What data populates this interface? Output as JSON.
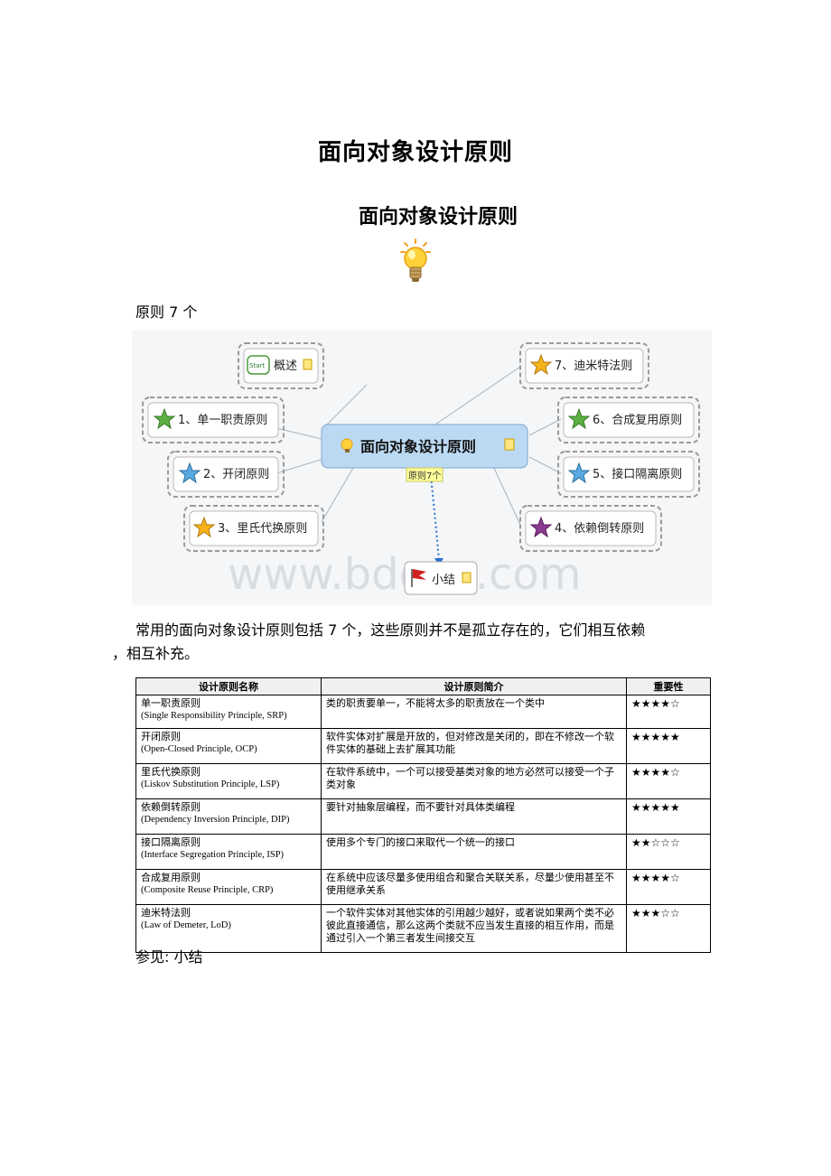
{
  "document": {
    "title": "面向对象设计原则",
    "subtitle": "面向对象设计原则",
    "count_line": "原则 7 个",
    "description_line1": "常用的面向对象设计原则包括 7 个，这些原则并不是孤立存在的，它们相互依赖",
    "description_line2": "，相互补充。",
    "see_also": "参见: 小结"
  },
  "mindmap": {
    "center": "面向对象设计原则",
    "link_label": "原则7个",
    "start_badge": "Start",
    "watermark": "www.bdocx.com",
    "nodes": {
      "overview": "概述",
      "srp": "1、单一职责原则",
      "ocp": "2、开闭原则",
      "lsp": "3、里氏代换原则",
      "dip": "4、依赖倒转原则",
      "isp": "5、接口隔离原则",
      "crp": "6、合成复用原则",
      "lod": "7、迪米特法则",
      "summary": "小结"
    },
    "colors": {
      "green_star": "#5bb040",
      "blue_star": "#5aa9df",
      "yellow_star": "#f5b21b",
      "purple_star": "#8b3c8e",
      "center_fill": "#bcd9f3",
      "link_label_bg": "#ffff99"
    }
  },
  "table": {
    "headers": [
      "设计原则名称",
      "设计原则简介",
      "重要性"
    ],
    "rows": [
      {
        "name": "单一职责原则",
        "en": "(Single Responsibility  Principle, SRP)",
        "desc": "类的职责要单一，不能将太多的职责放在一个类中",
        "stars": "★★★★☆"
      },
      {
        "name": "开闭原则",
        "en": "(Open-Closed Principle,  OCP)",
        "desc": "软件实体对扩展是开放的，但对修改是关闭的，即在不修改一个软件实体的基础上去扩展其功能",
        "stars": "★★★★★"
      },
      {
        "name": "里氏代换原则",
        "en": "(Liskov Substitution  Principle, LSP)",
        "desc": "在软件系统中，一个可以接受基类对象的地方必然可以接受一个子类对象",
        "stars": "★★★★☆"
      },
      {
        "name": "依赖倒转原则",
        "en": "(Dependency Inversion Principle, DIP)",
        "desc": "要针对抽象层编程，而不要针对具体类编程",
        "stars": "★★★★★"
      },
      {
        "name": "接口隔离原则",
        "en": "(Interface  Segregation  Principle, ISP)",
        "desc": "使用多个专门的接口来取代一个统一的接口",
        "stars": "★★☆☆☆"
      },
      {
        "name": "合成复用原则",
        "en": "(Composite Reuse Principle,  CRP)",
        "desc": "在系统中应该尽量多使用组合和聚合关联关系，尽量少使用甚至不使用继承关系",
        "stars": "★★★★☆"
      },
      {
        "name": "迪米特法则",
        "en": "(Law of Demeter,  LoD)",
        "desc": "一个软件实体对其他实体的引用越少越好，或者说如果两个类不必彼此直接通信，那么这两个类就不应当发生直接的相互作用，而是通过引入一个第三者发生间接交互",
        "stars": "★★★☆☆"
      }
    ]
  }
}
